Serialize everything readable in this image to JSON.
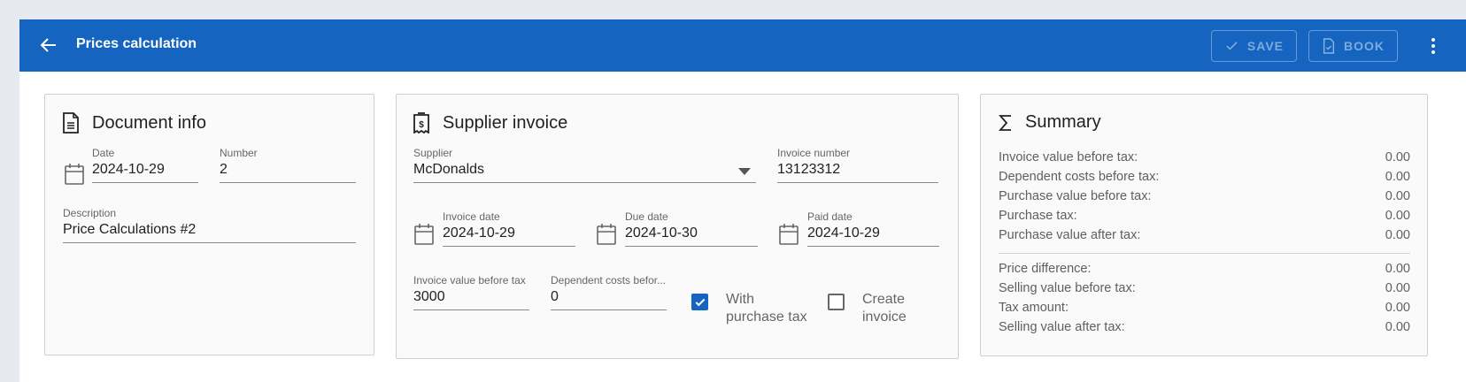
{
  "header": {
    "title": "Prices calculation",
    "save_label": "SAVE",
    "book_label": "BOOK"
  },
  "document_info": {
    "title": "Document info",
    "date": {
      "label": "Date",
      "value": "2024-10-29"
    },
    "number": {
      "label": "Number",
      "value": "2"
    },
    "description": {
      "label": "Description",
      "value": "Price Calculations #2"
    }
  },
  "supplier_invoice": {
    "title": "Supplier invoice",
    "supplier": {
      "label": "Supplier",
      "value": "McDonalds"
    },
    "invoice_number": {
      "label": "Invoice number",
      "value": "13123312"
    },
    "invoice_date": {
      "label": "Invoice date",
      "value": "2024-10-29"
    },
    "due_date": {
      "label": "Due date",
      "value": "2024-10-30"
    },
    "paid_date": {
      "label": "Paid date",
      "value": "2024-10-29"
    },
    "invoice_value": {
      "label": "Invoice value before tax",
      "value": "3000"
    },
    "dependent_costs": {
      "label": "Dependent costs befor...",
      "value": "0"
    },
    "with_purchase_tax": {
      "label": "With purchase tax",
      "checked": true
    },
    "create_invoice": {
      "label": "Create invoice",
      "checked": false
    }
  },
  "summary": {
    "title": "Summary",
    "rows_top": [
      {
        "label": "Invoice value before tax:",
        "value": "0.00"
      },
      {
        "label": "Dependent costs before tax:",
        "value": "0.00"
      },
      {
        "label": "Purchase value before tax:",
        "value": "0.00"
      },
      {
        "label": "Purchase tax:",
        "value": "0.00"
      },
      {
        "label": "Purchase value after tax:",
        "value": "0.00"
      }
    ],
    "rows_bottom": [
      {
        "label": "Price difference:",
        "value": "0.00"
      },
      {
        "label": "Selling value before tax:",
        "value": "0.00"
      },
      {
        "label": "Tax amount:",
        "value": "0.00"
      },
      {
        "label": "Selling value after tax:",
        "value": "0.00"
      }
    ]
  },
  "colors": {
    "primary": "#1565c0",
    "card_bg": "#fafafa",
    "page_bg": "#e6e9f0"
  },
  "icons": [
    "arrow-left-icon",
    "check-icon",
    "document-check-icon",
    "more-vert-icon",
    "document-icon",
    "receipt-dollar-icon",
    "sigma-icon",
    "calendar-icon",
    "dropdown-arrow-icon"
  ]
}
